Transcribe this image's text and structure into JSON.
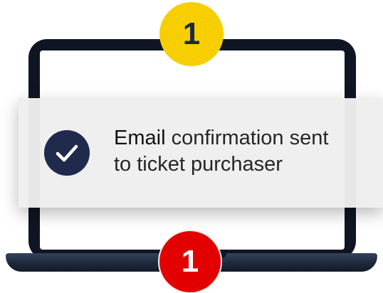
{
  "notification": {
    "message_highlight": "Email",
    "message_rest": " confirmation sent",
    "message_line2": "to ticket purchaser",
    "icon": "checkmark-icon"
  },
  "badges": {
    "top_number": "1",
    "bottom_number": "1"
  },
  "colors": {
    "badge_top": "#f7cf00",
    "badge_bottom": "#e30000",
    "check_circle": "#1f2a4d",
    "laptop_body": "#0f1522"
  }
}
